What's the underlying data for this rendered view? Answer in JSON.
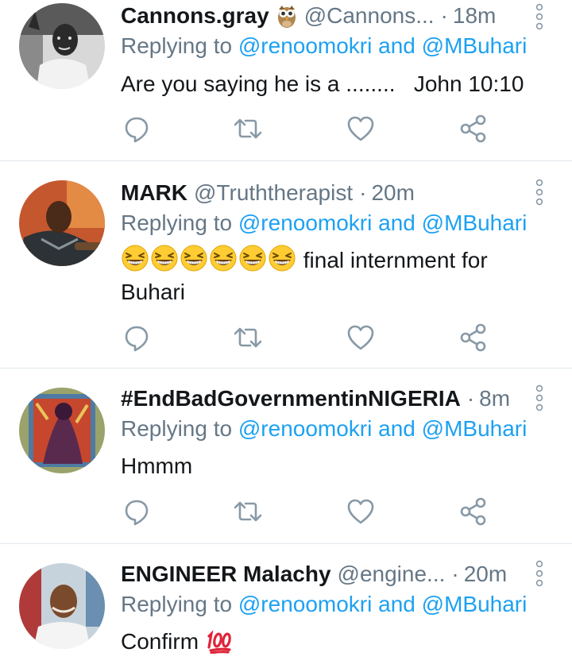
{
  "colors": {
    "link": "#1da1f2",
    "muted": "#657786",
    "text": "#14171a",
    "divider": "#e1e8ed"
  },
  "tweets": [
    {
      "name": "Cannons.gray",
      "badge_icon": "owl-icon",
      "handle": "@Cannons...",
      "dot": "·",
      "time": "18m",
      "reply_prefix": "Replying to",
      "mention1": "@renoomokri",
      "and": "and",
      "mention2": "@MBuhari",
      "text": "Are you saying he is a ........   John 10:10"
    },
    {
      "name": "MARK",
      "handle": "@Truththerapist",
      "dot": "·",
      "time": "20m",
      "reply_prefix": "Replying to",
      "mention1": "@renoomokri",
      "and": "and",
      "mention2": "@MBuhari",
      "emoji_icon": "grinning-squinting-face-emoji",
      "emoji_count": 6,
      "text": "final  internment for Buhari"
    },
    {
      "name": "#EndBadGovernmentinNIGERIA",
      "dot": "·",
      "time": "8m",
      "reply_prefix": "Replying to",
      "mention1": "@renoomokri",
      "and": "and",
      "mention2": "@MBuhari",
      "text": "Hmmm"
    },
    {
      "name": "ENGINEER Malachy",
      "handle": "@engine...",
      "dot": "·",
      "time": "20m",
      "reply_prefix": "Replying to",
      "mention1": "@renoomokri",
      "and": "and",
      "mention2": "@MBuhari",
      "text": "Confirm",
      "emoji_icon": "hundred-points-emoji"
    }
  ]
}
